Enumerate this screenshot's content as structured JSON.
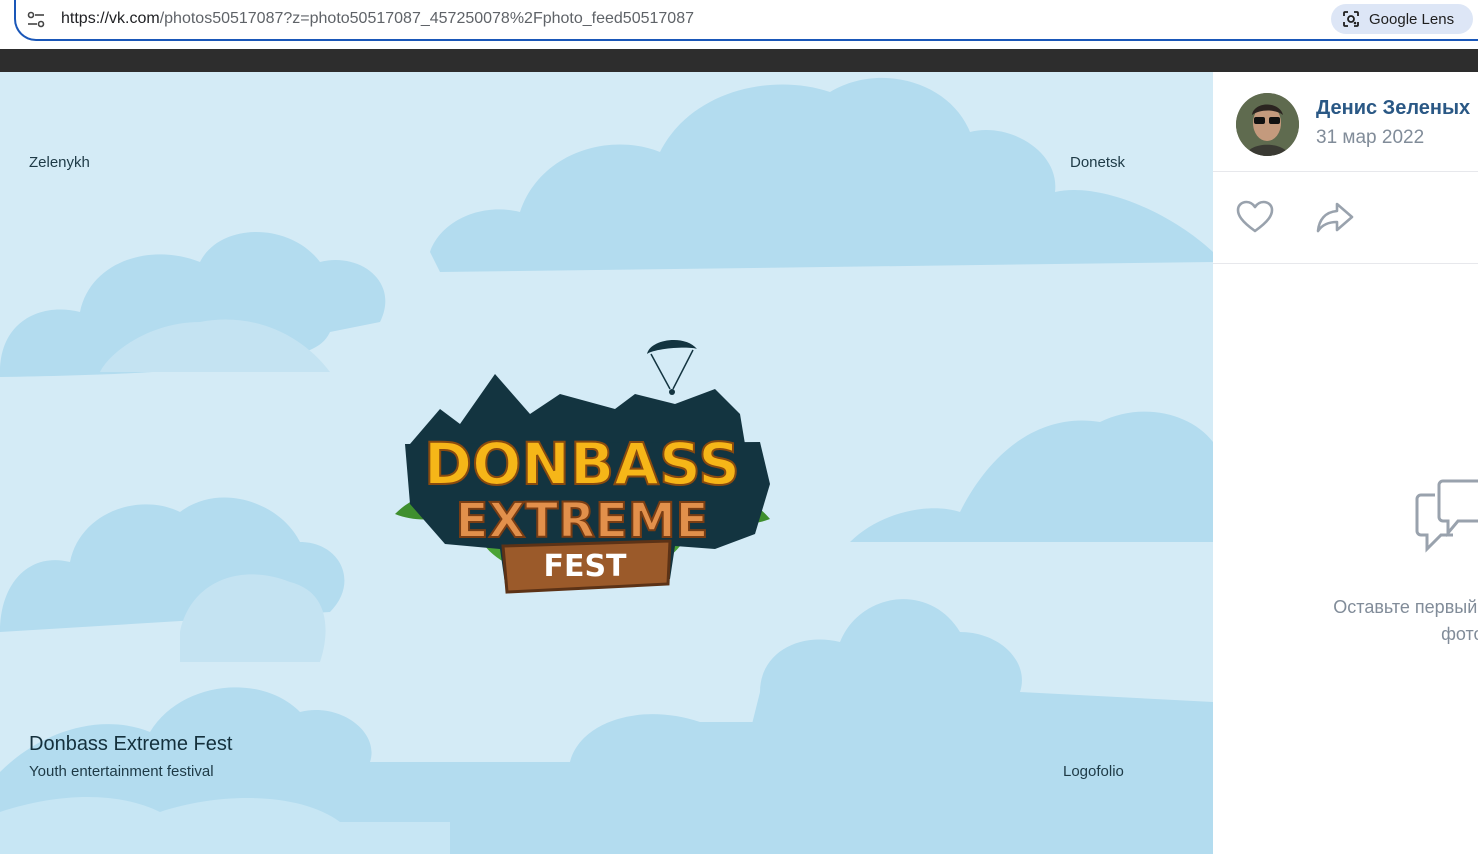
{
  "browser": {
    "url_host": "https://vk.com",
    "url_path": "/photos50517087?z=photo50517087_457250078%2Fphoto_feed50517087",
    "lens_label": "Google Lens",
    "accent": "#1a57b8"
  },
  "photo": {
    "top_left_label": "Zelenykh",
    "top_right_label": "Donetsk",
    "title": "Donbass Extreme Fest",
    "subtitle": "Youth entertainment festival",
    "bottom_right_label": "Logofolio",
    "logo": {
      "line1": "DONBASS",
      "line2": "EXTREME",
      "line3": "FEST"
    },
    "background_color": "#d4ebf6"
  },
  "panel": {
    "author_name": "Денис Зеленых",
    "date": "31 мар 2022",
    "empty_comments_line1": "Оставьте первый ком",
    "empty_comments_line2": "фотограф",
    "link_color": "#2a5885"
  }
}
